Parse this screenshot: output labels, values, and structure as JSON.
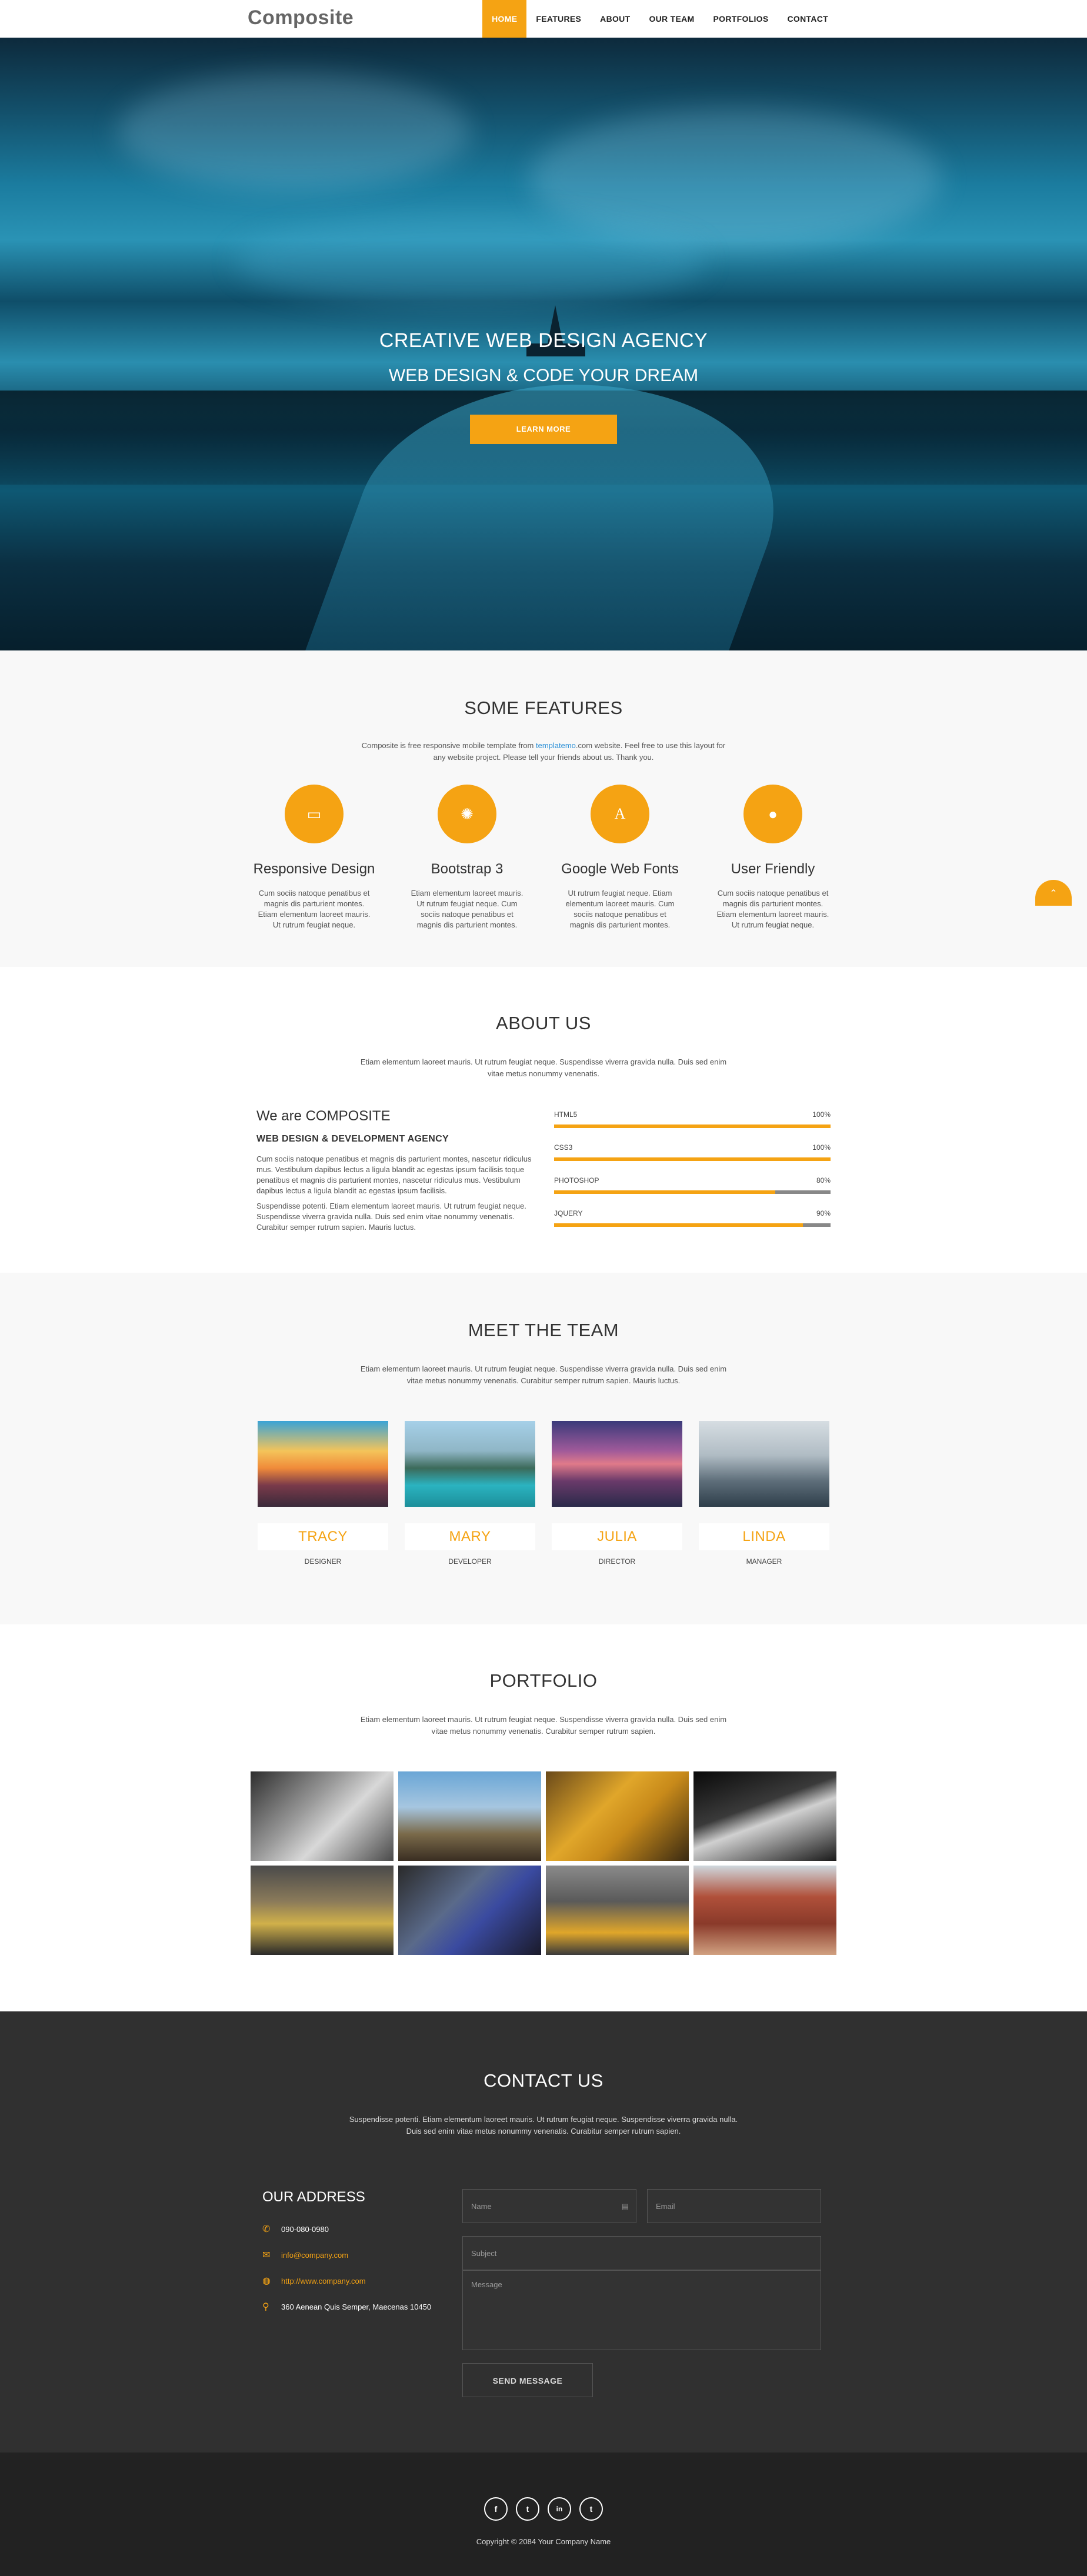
{
  "nav": {
    "brand": "Composite",
    "items": [
      "HOME",
      "FEATURES",
      "ABOUT",
      "OUR TEAM",
      "PORTFOLIOS",
      "CONTACT"
    ],
    "active": "HOME"
  },
  "hero": {
    "title": "CREATIVE WEB DESIGN AGENCY",
    "subtitle": "WEB DESIGN & CODE YOUR DREAM",
    "button": "LEARN MORE"
  },
  "features": {
    "title": "SOME FEATURES",
    "sub_before": "Composite is free responsive mobile template from ",
    "sub_link": "templatemo",
    "sub_after": ".com website. Feel free to use this layout for any website project. Please tell your friends about us. Thank you.",
    "items": [
      {
        "icon": "laptop-icon",
        "glyph": "▭",
        "title": "Responsive Design",
        "text": "Cum sociis natoque penatibus et magnis dis parturient montes. Etiam elementum laoreet mauris. Ut rutrum feugiat neque."
      },
      {
        "icon": "gear-icon",
        "glyph": "✺",
        "title": "Bootstrap 3",
        "text": "Etiam elementum laoreet mauris. Ut rutrum feugiat neque. Cum sociis natoque penatibus et magnis dis parturient montes."
      },
      {
        "icon": "font-icon",
        "glyph": "A",
        "title": "Google Web Fonts",
        "text": "Ut rutrum feugiat neque. Etiam elementum laoreet mauris. Cum sociis natoque penatibus et magnis dis parturient montes."
      },
      {
        "icon": "user-icon",
        "glyph": "●",
        "title": "User Friendly",
        "text": "Cum sociis natoque penatibus et magnis dis parturient montes. Etiam elementum laoreet mauris. Ut rutrum feugiat neque."
      }
    ],
    "back_to_top": "⌃"
  },
  "about": {
    "title": "ABOUT US",
    "sub": "Etiam elementum laoreet mauris. Ut rutrum feugiat neque. Suspendisse viverra gravida nulla. Duis sed enim vitae metus nonummy venenatis.",
    "heading": "We are COMPOSITE",
    "subheading": "WEB DESIGN & DEVELOPMENT AGENCY",
    "p1": "Cum sociis natoque penatibus et magnis dis parturient montes, nascetur ridiculus mus. Vestibulum dapibus lectus a ligula blandit ac egestas ipsum facilisis toque penatibus et magnis dis parturient montes, nascetur ridiculus mus. Vestibulum dapibus lectus a ligula blandit ac egestas ipsum facilisis.",
    "p2": "Suspendisse potenti. Etiam elementum laoreet mauris. Ut rutrum feugiat neque. Suspendisse viverra gravida nulla. Duis sed enim vitae nonummy venenatis. Curabitur semper rutrum sapien. Mauris luctus.",
    "skills": [
      {
        "name": "HTML5",
        "label": "100%",
        "value": 100
      },
      {
        "name": "CSS3",
        "label": "100%",
        "value": 100
      },
      {
        "name": "PHOTOSHOP",
        "label": "80%",
        "value": 80
      },
      {
        "name": "JQUERY",
        "label": "90%",
        "value": 90
      }
    ]
  },
  "team": {
    "title": "MEET THE TEAM",
    "sub": "Etiam elementum laoreet mauris. Ut rutrum feugiat neque. Suspendisse viverra gravida nulla. Duis sed enim vitae metus nonummy venenatis. Curabitur semper rutrum sapien. Mauris luctus.",
    "members": [
      {
        "name": "TRACY",
        "role": "DESIGNER"
      },
      {
        "name": "MARY",
        "role": "DEVELOPER"
      },
      {
        "name": "JULIA",
        "role": "DIRECTOR"
      },
      {
        "name": "LINDA",
        "role": "MANAGER"
      }
    ]
  },
  "portfolio": {
    "title": "PORTFOLIO",
    "sub": "Etiam elementum laoreet mauris. Ut rutrum feugiat neque. Suspendisse viverra gravida nulla. Duis sed enim vitae metus nonummy venenatis. Curabitur semper rutrum sapien."
  },
  "contact": {
    "title": "CONTACT US",
    "sub": "Suspendisse potenti. Etiam elementum laoreet mauris. Ut rutrum feugiat neque. Suspendisse viverra gravida nulla. Duis sed enim vitae metus nonummy venenatis. Curabitur semper rutrum sapien.",
    "address_title": "OUR ADDRESS",
    "phone": "090-080-0980",
    "email": "info@company.com",
    "website": "http://www.company.com",
    "address": "360 Aenean Quis Semper, Maecenas 10450",
    "form": {
      "name_placeholder": "Name",
      "email_placeholder": "Email",
      "subject_placeholder": "Subject",
      "message_placeholder": "Message",
      "send_label": "SEND MESSAGE"
    }
  },
  "footer": {
    "socials": [
      {
        "name": "facebook-icon",
        "glyph": "f"
      },
      {
        "name": "twitter-icon",
        "glyph": "t"
      },
      {
        "name": "linkedin-icon",
        "glyph": "in"
      },
      {
        "name": "tumblr-icon",
        "glyph": "t"
      }
    ],
    "copyright": "Copyright © 2084 Your Company Name"
  },
  "colors": {
    "accent": "#f5a313",
    "dark": "#303030",
    "footer": "#222222"
  }
}
